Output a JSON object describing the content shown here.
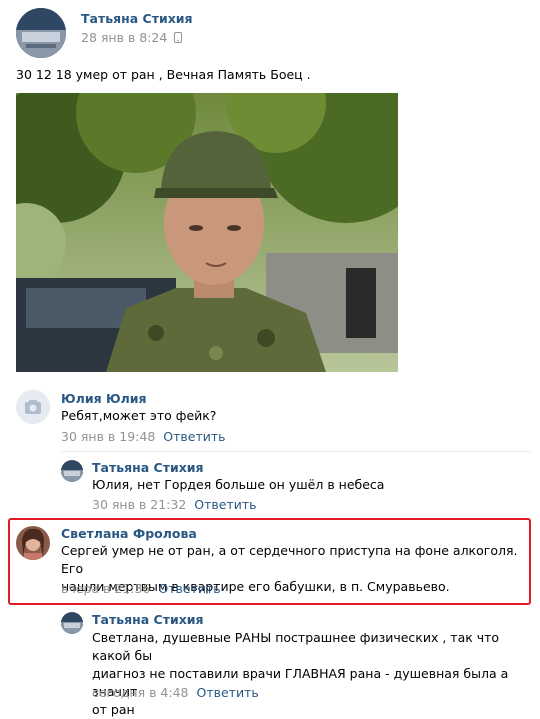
{
  "post": {
    "author": "Татьяна Стихия",
    "date": "28 янв в 8:24",
    "text": "30 12 18 умер от ран , Вечная Память Боец ."
  },
  "comments": [
    {
      "author": "Юлия Юлия",
      "text": "Ребят,может это фейк?",
      "date": "30 янв в 19:48",
      "reply_label": "Ответить"
    },
    {
      "author": "Татьяна Стихия",
      "text": "Юлия, нет Гордея больше он ушёл в небеса",
      "date": "30 янв в 21:32",
      "reply_label": "Ответить"
    },
    {
      "author": "Светлана Фролова",
      "text_line1": "Сергей умер не от ран, а от сердечного приступа на фоне алкоголя. Его",
      "text_line2": "нашли мертвым в квартире его бабушки, в п. Смуравьево.",
      "date": "вчера в 21:36",
      "reply_label": "Ответить",
      "highlight_color": "#e01b24"
    },
    {
      "author": "Татьяна Стихия",
      "text_line1": "Светлана, душевные РАНЫ пострашнее физических , так что какой бы",
      "text_line2": "диагноз не поставили врачи ГЛАВНАЯ рана - душевная была а значит",
      "text_line3": "от ран",
      "date": "сегодня в 4:48",
      "reply_label": "Ответить"
    }
  ],
  "icons": {
    "mobile": "phone-icon",
    "camera": "camera-icon"
  }
}
